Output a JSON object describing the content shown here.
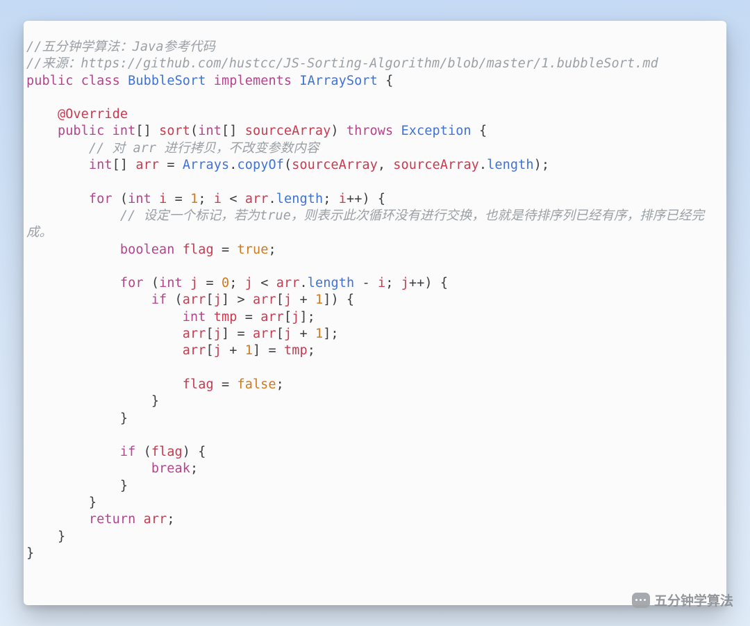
{
  "code": {
    "indent": "    ",
    "lines": [
      {
        "i": 0,
        "t": [
          {
            "c": "comment",
            "v": "//五分钟学算法：Java参考代码"
          }
        ]
      },
      {
        "i": 0,
        "t": [
          {
            "c": "comment",
            "v": "//来源：https://github.com/hustcc/JS-Sorting-Algorithm/blob/master/1.bubbleSort.md"
          }
        ]
      },
      {
        "i": 0,
        "t": [
          {
            "c": "keyword",
            "v": "public"
          },
          {
            "c": "plain",
            "v": " "
          },
          {
            "c": "keyword",
            "v": "class"
          },
          {
            "c": "plain",
            "v": " "
          },
          {
            "c": "classname",
            "v": "BubbleSort"
          },
          {
            "c": "plain",
            "v": " "
          },
          {
            "c": "keyword",
            "v": "implements"
          },
          {
            "c": "plain",
            "v": " "
          },
          {
            "c": "classname",
            "v": "IArraySort"
          },
          {
            "c": "plain",
            "v": " "
          },
          {
            "c": "punct",
            "v": "{"
          }
        ]
      },
      {
        "i": 0,
        "t": []
      },
      {
        "i": 1,
        "t": [
          {
            "c": "annotation",
            "v": "@Override"
          }
        ]
      },
      {
        "i": 1,
        "t": [
          {
            "c": "keyword",
            "v": "public"
          },
          {
            "c": "plain",
            "v": " "
          },
          {
            "c": "type",
            "v": "int"
          },
          {
            "c": "punct",
            "v": "[] "
          },
          {
            "c": "funcname",
            "v": "sort"
          },
          {
            "c": "punct",
            "v": "("
          },
          {
            "c": "type",
            "v": "int"
          },
          {
            "c": "punct",
            "v": "[] "
          },
          {
            "c": "paramname",
            "v": "sourceArray"
          },
          {
            "c": "punct",
            "v": ")"
          },
          {
            "c": "plain",
            "v": " "
          },
          {
            "c": "keyword",
            "v": "throws"
          },
          {
            "c": "plain",
            "v": " "
          },
          {
            "c": "classname",
            "v": "Exception"
          },
          {
            "c": "plain",
            "v": " "
          },
          {
            "c": "punct",
            "v": "{"
          }
        ]
      },
      {
        "i": 2,
        "t": [
          {
            "c": "comment",
            "v": "// 对 arr 进行拷贝，不改变参数内容"
          }
        ]
      },
      {
        "i": 2,
        "t": [
          {
            "c": "type",
            "v": "int"
          },
          {
            "c": "punct",
            "v": "[] "
          },
          {
            "c": "ident",
            "v": "arr"
          },
          {
            "c": "plain",
            "v": " "
          },
          {
            "c": "operator",
            "v": "="
          },
          {
            "c": "plain",
            "v": " "
          },
          {
            "c": "classname",
            "v": "Arrays"
          },
          {
            "c": "punct",
            "v": "."
          },
          {
            "c": "member",
            "v": "copyOf"
          },
          {
            "c": "punct",
            "v": "("
          },
          {
            "c": "ident",
            "v": "sourceArray"
          },
          {
            "c": "punct",
            "v": ", "
          },
          {
            "c": "ident",
            "v": "sourceArray"
          },
          {
            "c": "punct",
            "v": "."
          },
          {
            "c": "member",
            "v": "length"
          },
          {
            "c": "punct",
            "v": ");"
          }
        ]
      },
      {
        "i": 0,
        "t": []
      },
      {
        "i": 2,
        "t": [
          {
            "c": "keyword",
            "v": "for"
          },
          {
            "c": "plain",
            "v": " "
          },
          {
            "c": "punct",
            "v": "("
          },
          {
            "c": "type",
            "v": "int"
          },
          {
            "c": "plain",
            "v": " "
          },
          {
            "c": "ident",
            "v": "i"
          },
          {
            "c": "plain",
            "v": " "
          },
          {
            "c": "operator",
            "v": "="
          },
          {
            "c": "plain",
            "v": " "
          },
          {
            "c": "number",
            "v": "1"
          },
          {
            "c": "punct",
            "v": "; "
          },
          {
            "c": "ident",
            "v": "i"
          },
          {
            "c": "plain",
            "v": " "
          },
          {
            "c": "operator",
            "v": "<"
          },
          {
            "c": "plain",
            "v": " "
          },
          {
            "c": "ident",
            "v": "arr"
          },
          {
            "c": "punct",
            "v": "."
          },
          {
            "c": "member",
            "v": "length"
          },
          {
            "c": "punct",
            "v": "; "
          },
          {
            "c": "ident",
            "v": "i"
          },
          {
            "c": "operator",
            "v": "++"
          },
          {
            "c": "punct",
            "v": ") {"
          }
        ]
      },
      {
        "i": 3,
        "t": [
          {
            "c": "comment",
            "v": "// 设定一个标记，若为true，则表示此次循环没有进行交换，也就是待排序列已经有序，排序已经完成。"
          }
        ]
      },
      {
        "i": 3,
        "t": [
          {
            "c": "type",
            "v": "boolean"
          },
          {
            "c": "plain",
            "v": " "
          },
          {
            "c": "ident",
            "v": "flag"
          },
          {
            "c": "plain",
            "v": " "
          },
          {
            "c": "operator",
            "v": "="
          },
          {
            "c": "plain",
            "v": " "
          },
          {
            "c": "bool",
            "v": "true"
          },
          {
            "c": "punct",
            "v": ";"
          }
        ]
      },
      {
        "i": 0,
        "t": []
      },
      {
        "i": 3,
        "t": [
          {
            "c": "keyword",
            "v": "for"
          },
          {
            "c": "plain",
            "v": " "
          },
          {
            "c": "punct",
            "v": "("
          },
          {
            "c": "type",
            "v": "int"
          },
          {
            "c": "plain",
            "v": " "
          },
          {
            "c": "ident",
            "v": "j"
          },
          {
            "c": "plain",
            "v": " "
          },
          {
            "c": "operator",
            "v": "="
          },
          {
            "c": "plain",
            "v": " "
          },
          {
            "c": "number",
            "v": "0"
          },
          {
            "c": "punct",
            "v": "; "
          },
          {
            "c": "ident",
            "v": "j"
          },
          {
            "c": "plain",
            "v": " "
          },
          {
            "c": "operator",
            "v": "<"
          },
          {
            "c": "plain",
            "v": " "
          },
          {
            "c": "ident",
            "v": "arr"
          },
          {
            "c": "punct",
            "v": "."
          },
          {
            "c": "member",
            "v": "length"
          },
          {
            "c": "plain",
            "v": " "
          },
          {
            "c": "operator",
            "v": "-"
          },
          {
            "c": "plain",
            "v": " "
          },
          {
            "c": "ident",
            "v": "i"
          },
          {
            "c": "punct",
            "v": "; "
          },
          {
            "c": "ident",
            "v": "j"
          },
          {
            "c": "operator",
            "v": "++"
          },
          {
            "c": "punct",
            "v": ") {"
          }
        ]
      },
      {
        "i": 4,
        "t": [
          {
            "c": "keyword",
            "v": "if"
          },
          {
            "c": "plain",
            "v": " "
          },
          {
            "c": "punct",
            "v": "("
          },
          {
            "c": "ident",
            "v": "arr"
          },
          {
            "c": "punct",
            "v": "["
          },
          {
            "c": "ident",
            "v": "j"
          },
          {
            "c": "punct",
            "v": "] "
          },
          {
            "c": "operator",
            "v": ">"
          },
          {
            "c": "plain",
            "v": " "
          },
          {
            "c": "ident",
            "v": "arr"
          },
          {
            "c": "punct",
            "v": "["
          },
          {
            "c": "ident",
            "v": "j"
          },
          {
            "c": "plain",
            "v": " "
          },
          {
            "c": "operator",
            "v": "+"
          },
          {
            "c": "plain",
            "v": " "
          },
          {
            "c": "number",
            "v": "1"
          },
          {
            "c": "punct",
            "v": "]) {"
          }
        ]
      },
      {
        "i": 5,
        "t": [
          {
            "c": "type",
            "v": "int"
          },
          {
            "c": "plain",
            "v": " "
          },
          {
            "c": "ident",
            "v": "tmp"
          },
          {
            "c": "plain",
            "v": " "
          },
          {
            "c": "operator",
            "v": "="
          },
          {
            "c": "plain",
            "v": " "
          },
          {
            "c": "ident",
            "v": "arr"
          },
          {
            "c": "punct",
            "v": "["
          },
          {
            "c": "ident",
            "v": "j"
          },
          {
            "c": "punct",
            "v": "];"
          }
        ]
      },
      {
        "i": 5,
        "t": [
          {
            "c": "ident",
            "v": "arr"
          },
          {
            "c": "punct",
            "v": "["
          },
          {
            "c": "ident",
            "v": "j"
          },
          {
            "c": "punct",
            "v": "] "
          },
          {
            "c": "operator",
            "v": "="
          },
          {
            "c": "plain",
            "v": " "
          },
          {
            "c": "ident",
            "v": "arr"
          },
          {
            "c": "punct",
            "v": "["
          },
          {
            "c": "ident",
            "v": "j"
          },
          {
            "c": "plain",
            "v": " "
          },
          {
            "c": "operator",
            "v": "+"
          },
          {
            "c": "plain",
            "v": " "
          },
          {
            "c": "number",
            "v": "1"
          },
          {
            "c": "punct",
            "v": "];"
          }
        ]
      },
      {
        "i": 5,
        "t": [
          {
            "c": "ident",
            "v": "arr"
          },
          {
            "c": "punct",
            "v": "["
          },
          {
            "c": "ident",
            "v": "j"
          },
          {
            "c": "plain",
            "v": " "
          },
          {
            "c": "operator",
            "v": "+"
          },
          {
            "c": "plain",
            "v": " "
          },
          {
            "c": "number",
            "v": "1"
          },
          {
            "c": "punct",
            "v": "] "
          },
          {
            "c": "operator",
            "v": "="
          },
          {
            "c": "plain",
            "v": " "
          },
          {
            "c": "ident",
            "v": "tmp"
          },
          {
            "c": "punct",
            "v": ";"
          }
        ]
      },
      {
        "i": 0,
        "t": []
      },
      {
        "i": 5,
        "t": [
          {
            "c": "ident",
            "v": "flag"
          },
          {
            "c": "plain",
            "v": " "
          },
          {
            "c": "operator",
            "v": "="
          },
          {
            "c": "plain",
            "v": " "
          },
          {
            "c": "bool",
            "v": "false"
          },
          {
            "c": "punct",
            "v": ";"
          }
        ]
      },
      {
        "i": 4,
        "t": [
          {
            "c": "punct",
            "v": "}"
          }
        ]
      },
      {
        "i": 3,
        "t": [
          {
            "c": "punct",
            "v": "}"
          }
        ]
      },
      {
        "i": 0,
        "t": []
      },
      {
        "i": 3,
        "t": [
          {
            "c": "keyword",
            "v": "if"
          },
          {
            "c": "plain",
            "v": " "
          },
          {
            "c": "punct",
            "v": "("
          },
          {
            "c": "ident",
            "v": "flag"
          },
          {
            "c": "punct",
            "v": ") {"
          }
        ]
      },
      {
        "i": 4,
        "t": [
          {
            "c": "keyword",
            "v": "break"
          },
          {
            "c": "punct",
            "v": ";"
          }
        ]
      },
      {
        "i": 3,
        "t": [
          {
            "c": "punct",
            "v": "}"
          }
        ]
      },
      {
        "i": 2,
        "t": [
          {
            "c": "punct",
            "v": "}"
          }
        ]
      },
      {
        "i": 2,
        "t": [
          {
            "c": "keyword",
            "v": "return"
          },
          {
            "c": "plain",
            "v": " "
          },
          {
            "c": "ident",
            "v": "arr"
          },
          {
            "c": "punct",
            "v": ";"
          }
        ]
      },
      {
        "i": 1,
        "t": [
          {
            "c": "punct",
            "v": "}"
          }
        ]
      },
      {
        "i": 0,
        "t": [
          {
            "c": "punct",
            "v": "}"
          }
        ]
      }
    ]
  },
  "watermark": {
    "label": "五分钟学算法"
  }
}
